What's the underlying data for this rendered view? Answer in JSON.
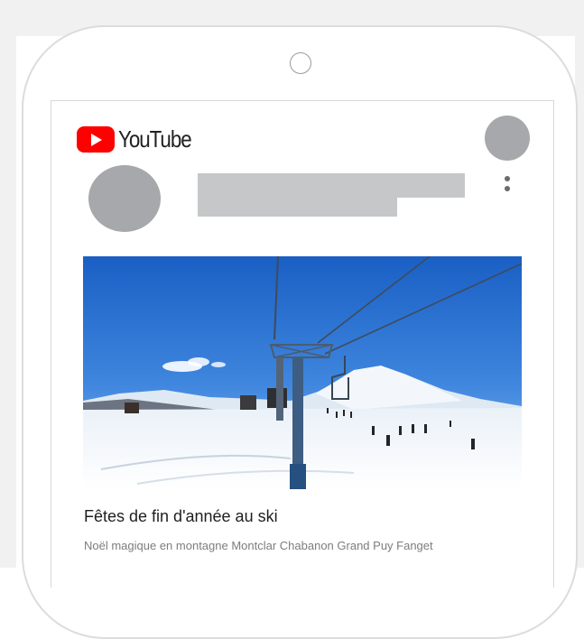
{
  "app": {
    "logo_text": "YouTube",
    "brand_color": "#ff0000"
  },
  "icons": {
    "logo": "youtube-play-icon",
    "menu": "more-vert-icon"
  },
  "card": {
    "video_title": "Fêtes de fin d'année au ski",
    "video_description": "Noël magique en montagne Montclar Chabanon Grand Puy Fanget"
  }
}
